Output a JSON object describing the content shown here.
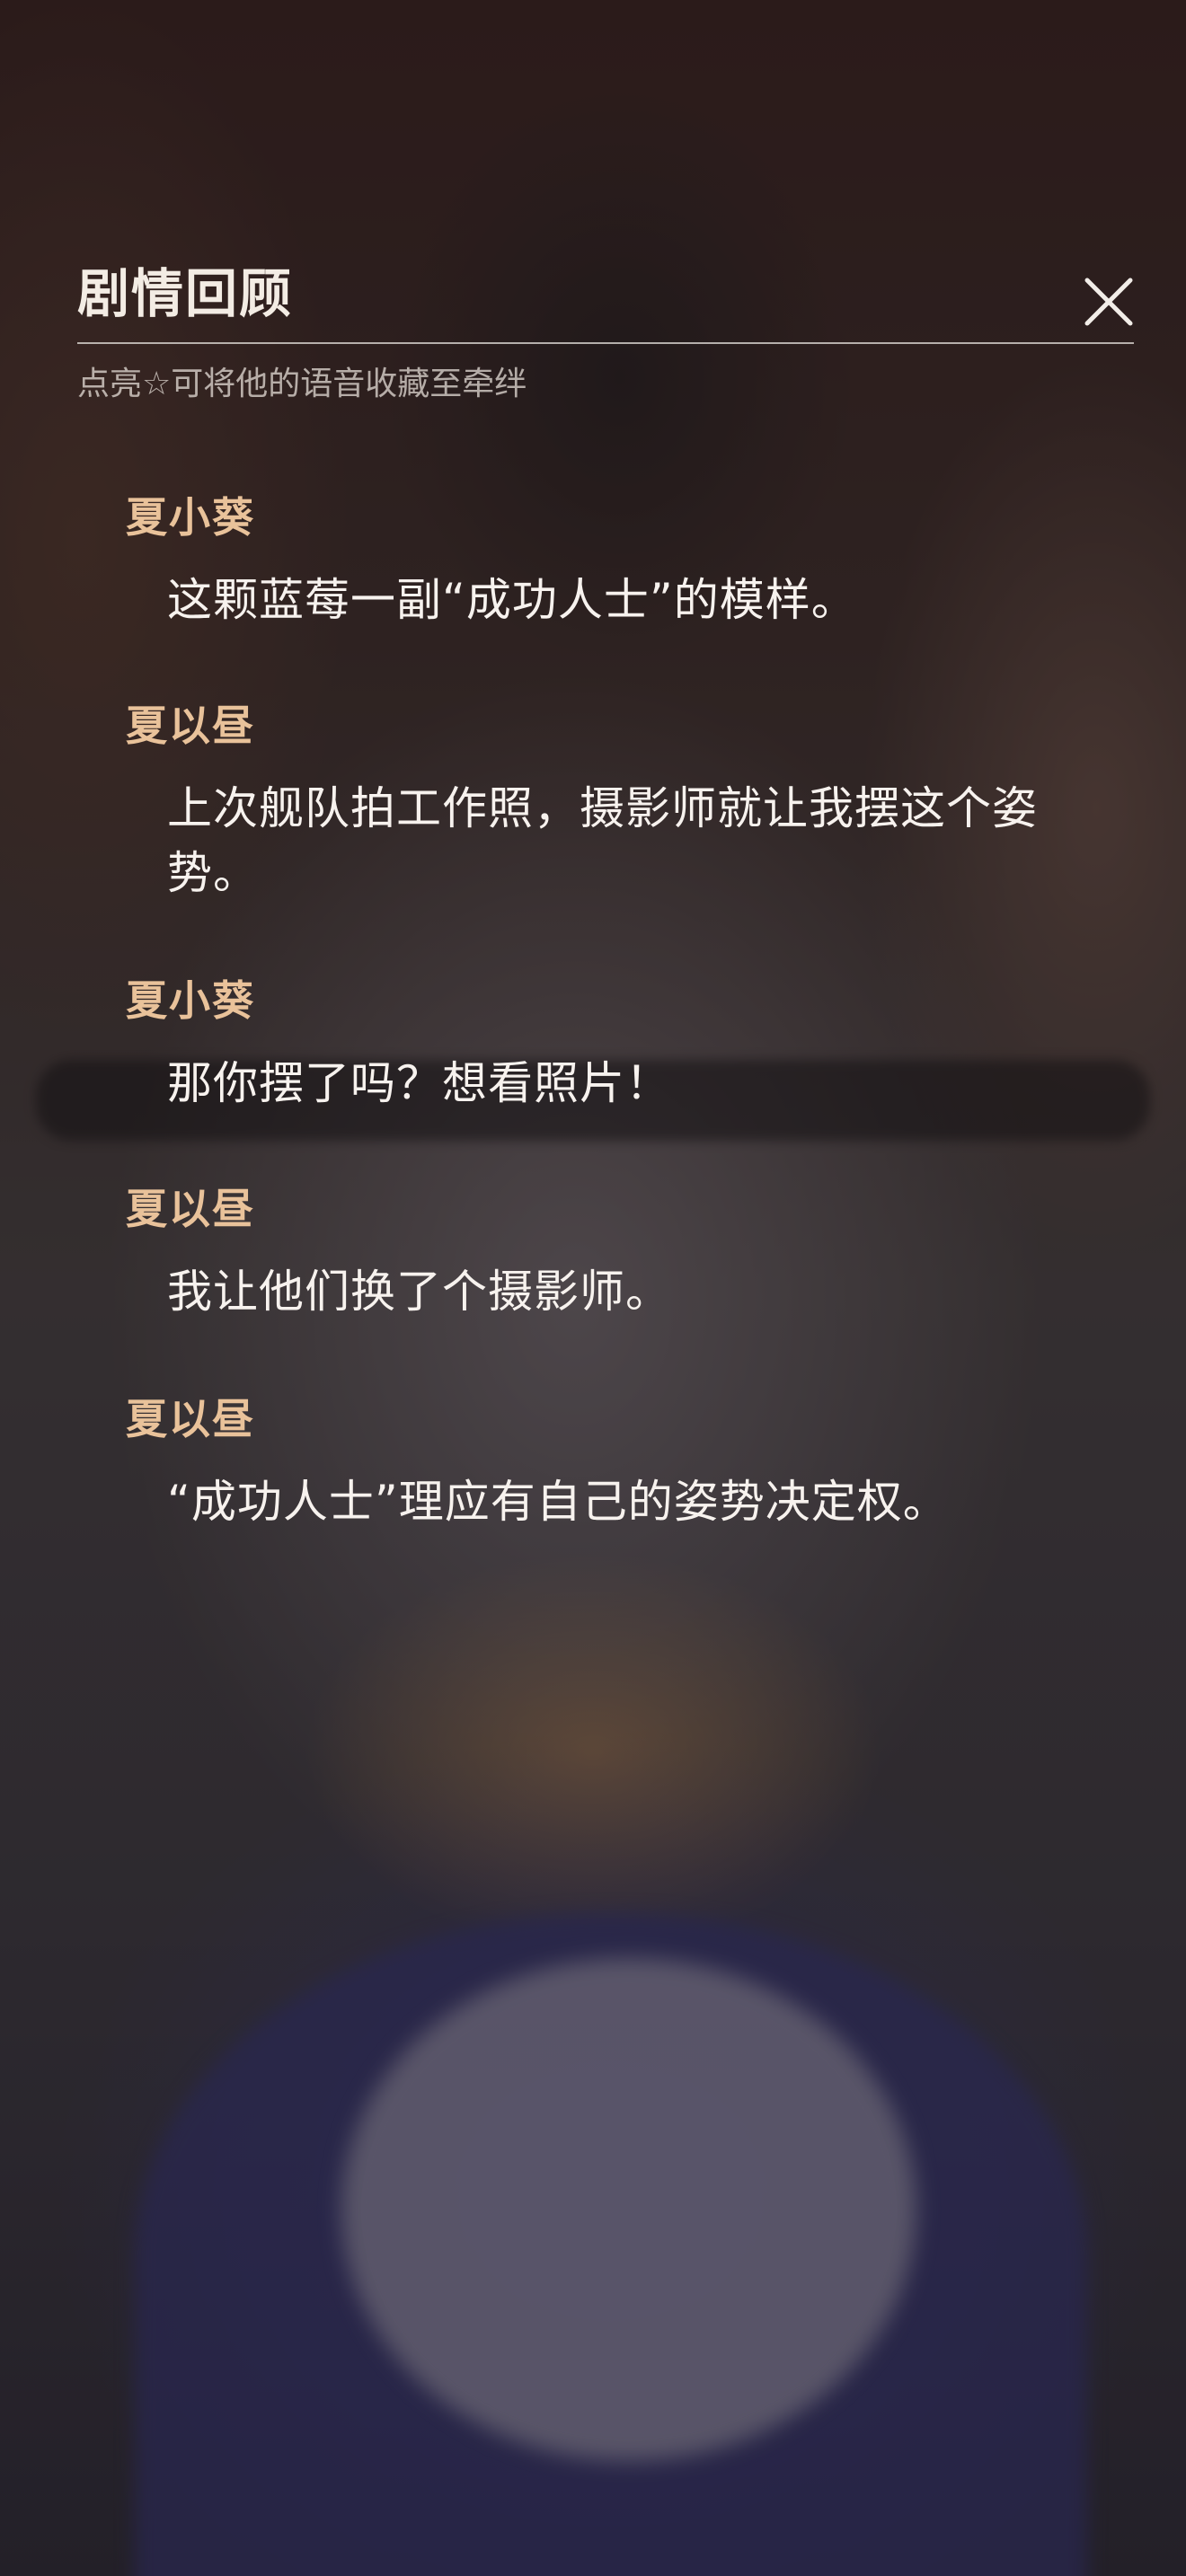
{
  "header": {
    "title": "剧情回顾",
    "hint": "点亮☆可将他的语音收藏至牵绊",
    "close_icon": "close-icon"
  },
  "dialogue": [
    {
      "speaker": "夏小葵",
      "text": "这颗蓝莓一副“成功人士”的模样。"
    },
    {
      "speaker": "夏以昼",
      "text": "上次舰队拍工作照，摄影师就让我摆这个姿势。"
    },
    {
      "speaker": "夏小葵",
      "text": "那你摆了吗？想看照片！"
    },
    {
      "speaker": "夏以昼",
      "text": "我让他们换了个摄影师。"
    },
    {
      "speaker": "夏以昼",
      "text": "“成功人士”理应有自己的姿势决定权。"
    }
  ],
  "colors": {
    "speaker": "#e9c29a",
    "text": "#f7f2ee",
    "title": "#f3ece4"
  }
}
